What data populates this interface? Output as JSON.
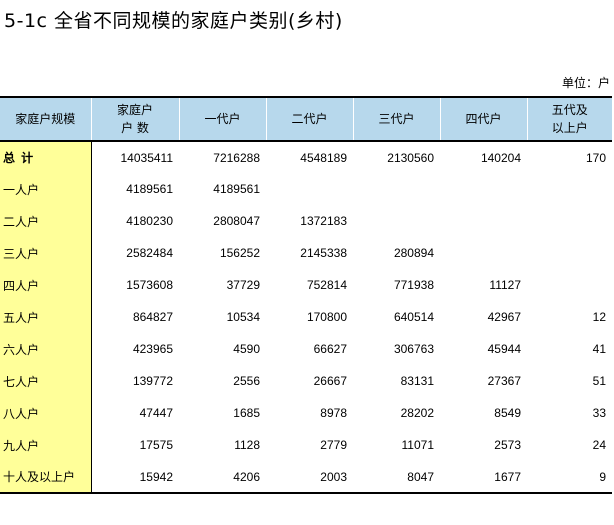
{
  "title": "5-1c   全省不同规模的家庭户类别(乡村)",
  "unit": "单位：户",
  "headers": {
    "col0": "家庭户规模",
    "col1_line1": "家庭户",
    "col1_line2": "户  数",
    "col2": "一代户",
    "col3": "二代户",
    "col4": "三代户",
    "col5": "四代户",
    "col6_line1": "五代及",
    "col6_line2": "以上户"
  },
  "rows": [
    {
      "label": "总  计",
      "cells": [
        "14035411",
        "7216288",
        "4548189",
        "2130560",
        "140204",
        "170"
      ]
    },
    {
      "label": "一人户",
      "cells": [
        "4189561",
        "4189561",
        "",
        "",
        "",
        ""
      ]
    },
    {
      "label": "二人户",
      "cells": [
        "4180230",
        "2808047",
        "1372183",
        "",
        "",
        ""
      ]
    },
    {
      "label": "三人户",
      "cells": [
        "2582484",
        "156252",
        "2145338",
        "280894",
        "",
        ""
      ]
    },
    {
      "label": "四人户",
      "cells": [
        "1573608",
        "37729",
        "752814",
        "771938",
        "11127",
        ""
      ]
    },
    {
      "label": "五人户",
      "cells": [
        "864827",
        "10534",
        "170800",
        "640514",
        "42967",
        "12"
      ]
    },
    {
      "label": "六人户",
      "cells": [
        "423965",
        "4590",
        "66627",
        "306763",
        "45944",
        "41"
      ]
    },
    {
      "label": "七人户",
      "cells": [
        "139772",
        "2556",
        "26667",
        "83131",
        "27367",
        "51"
      ]
    },
    {
      "label": "八人户",
      "cells": [
        "47447",
        "1685",
        "8978",
        "28202",
        "8549",
        "33"
      ]
    },
    {
      "label": "九人户",
      "cells": [
        "17575",
        "1128",
        "2779",
        "11071",
        "2573",
        "24"
      ]
    },
    {
      "label": "十人及以上户",
      "cells": [
        "15942",
        "4206",
        "2003",
        "8047",
        "1677",
        "9"
      ]
    }
  ]
}
